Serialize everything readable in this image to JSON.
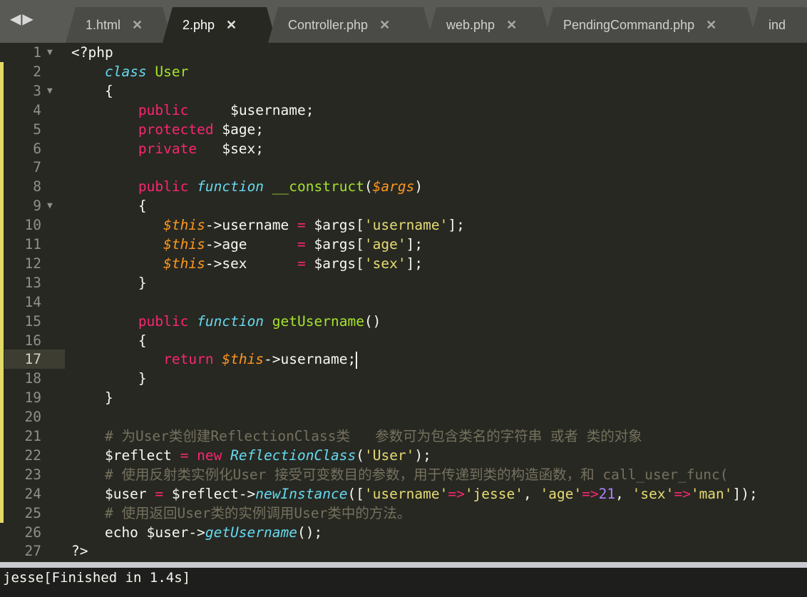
{
  "tabs": [
    {
      "label": "1.html",
      "active": false
    },
    {
      "label": "2.php",
      "active": true
    },
    {
      "label": "Controller.php",
      "active": false
    },
    {
      "label": "web.php",
      "active": false
    },
    {
      "label": "PendingCommand.php",
      "active": false
    },
    {
      "label": "ind",
      "active": false
    }
  ],
  "nav_arrows": "◀▶",
  "close_glyph": "✕",
  "fold_glyph": "▼",
  "current_line": 17,
  "code": {
    "lines": [
      {
        "n": "1",
        "fold": true,
        "tokens": [
          [
            "<?php",
            ""
          ]
        ]
      },
      {
        "n": "2",
        "tokens": [
          [
            "    ",
            ""
          ],
          [
            "class",
            "t-st"
          ],
          [
            " ",
            ""
          ],
          [
            "User",
            "t-cl"
          ]
        ]
      },
      {
        "n": "3",
        "fold": true,
        "tokens": [
          [
            "    {",
            ""
          ]
        ]
      },
      {
        "n": "4",
        "tokens": [
          [
            "        ",
            ""
          ],
          [
            "public",
            "t-kw"
          ],
          [
            "     $username;",
            ""
          ]
        ]
      },
      {
        "n": "5",
        "tokens": [
          [
            "        ",
            ""
          ],
          [
            "protected",
            "t-kw"
          ],
          [
            " $age;",
            ""
          ]
        ]
      },
      {
        "n": "6",
        "tokens": [
          [
            "        ",
            ""
          ],
          [
            "private",
            "t-kw"
          ],
          [
            "   $sex;",
            ""
          ]
        ]
      },
      {
        "n": "7",
        "tokens": []
      },
      {
        "n": "8",
        "tokens": [
          [
            "        ",
            ""
          ],
          [
            "public",
            "t-kw"
          ],
          [
            " ",
            ""
          ],
          [
            "function",
            "t-st"
          ],
          [
            " ",
            ""
          ],
          [
            "__construct",
            "t-fn"
          ],
          [
            "(",
            ""
          ],
          [
            "$args",
            "t-var"
          ],
          [
            ")",
            ""
          ]
        ]
      },
      {
        "n": "9",
        "fold": true,
        "tokens": [
          [
            "        {",
            ""
          ]
        ]
      },
      {
        "n": "10",
        "tokens": [
          [
            "           ",
            ""
          ],
          [
            "$this",
            "t-var"
          ],
          [
            "->username ",
            ""
          ],
          [
            "=",
            "t-kw"
          ],
          [
            " $args[",
            ""
          ],
          [
            "'username'",
            "t-str"
          ],
          [
            "];",
            ""
          ]
        ]
      },
      {
        "n": "11",
        "tokens": [
          [
            "           ",
            ""
          ],
          [
            "$this",
            "t-var"
          ],
          [
            "->age      ",
            ""
          ],
          [
            "=",
            "t-kw"
          ],
          [
            " $args[",
            ""
          ],
          [
            "'age'",
            "t-str"
          ],
          [
            "];",
            ""
          ]
        ]
      },
      {
        "n": "12",
        "tokens": [
          [
            "           ",
            ""
          ],
          [
            "$this",
            "t-var"
          ],
          [
            "->sex      ",
            ""
          ],
          [
            "=",
            "t-kw"
          ],
          [
            " $args[",
            ""
          ],
          [
            "'sex'",
            "t-str"
          ],
          [
            "];",
            ""
          ]
        ]
      },
      {
        "n": "13",
        "tokens": [
          [
            "        }",
            ""
          ]
        ]
      },
      {
        "n": "14",
        "tokens": []
      },
      {
        "n": "15",
        "tokens": [
          [
            "        ",
            ""
          ],
          [
            "public",
            "t-kw"
          ],
          [
            " ",
            ""
          ],
          [
            "function",
            "t-st"
          ],
          [
            " ",
            ""
          ],
          [
            "getUsername",
            "t-fn"
          ],
          [
            "()",
            ""
          ]
        ]
      },
      {
        "n": "16",
        "tokens": [
          [
            "        {",
            ""
          ]
        ]
      },
      {
        "n": "17",
        "tokens": [
          [
            "           ",
            ""
          ],
          [
            "return",
            "t-kw"
          ],
          [
            " ",
            ""
          ],
          [
            "$this",
            "t-var"
          ],
          [
            "->username;",
            ""
          ]
        ]
      },
      {
        "n": "18",
        "tokens": [
          [
            "        }",
            ""
          ]
        ]
      },
      {
        "n": "19",
        "tokens": [
          [
            "    }",
            ""
          ]
        ]
      },
      {
        "n": "20",
        "tokens": []
      },
      {
        "n": "21",
        "tokens": [
          [
            "    ",
            ""
          ],
          [
            "# 为User类创建ReflectionClass类   参数可为包含类名的字符串 或者 类的对象",
            "t-cm"
          ]
        ]
      },
      {
        "n": "22",
        "tokens": [
          [
            "    $reflect ",
            ""
          ],
          [
            "=",
            "t-kw"
          ],
          [
            " ",
            ""
          ],
          [
            "new",
            "t-kw"
          ],
          [
            " ",
            ""
          ],
          [
            "ReflectionClass",
            "t-sp"
          ],
          [
            "(",
            ""
          ],
          [
            "'User'",
            "t-str"
          ],
          [
            ");",
            ""
          ]
        ]
      },
      {
        "n": "23",
        "tokens": [
          [
            "    ",
            ""
          ],
          [
            "# 使用反射类实例化User 接受可变数目的参数，用于传递到类的构造函数，和 call_user_func(",
            "t-cm"
          ]
        ]
      },
      {
        "n": "24",
        "tokens": [
          [
            "    $user ",
            ""
          ],
          [
            "=",
            "t-kw"
          ],
          [
            " $reflect->",
            ""
          ],
          [
            "newInstance",
            "t-sp"
          ],
          [
            "([",
            ""
          ],
          [
            "'username'",
            "t-str"
          ],
          [
            "=>",
            "t-kw"
          ],
          [
            "'jesse'",
            "t-str"
          ],
          [
            ", ",
            ""
          ],
          [
            "'age'",
            "t-str"
          ],
          [
            "=>",
            "t-kw"
          ],
          [
            "21",
            "t-num"
          ],
          [
            ", ",
            ""
          ],
          [
            "'sex'",
            "t-str"
          ],
          [
            "=>",
            "t-kw"
          ],
          [
            "'man'",
            "t-str"
          ],
          [
            "]);",
            ""
          ]
        ]
      },
      {
        "n": "25",
        "tokens": [
          [
            "    ",
            ""
          ],
          [
            "# 使用返回User类的实例调用User类中的方法。",
            "t-cm"
          ]
        ]
      },
      {
        "n": "26",
        "tokens": [
          [
            "    echo $user->",
            ""
          ],
          [
            "getUsername",
            "t-sp"
          ],
          [
            "();",
            ""
          ]
        ]
      },
      {
        "n": "27",
        "tokens": [
          [
            "?>",
            ""
          ]
        ]
      }
    ]
  },
  "output": {
    "text": "jesse[Finished in 1.4s]"
  },
  "colors": {
    "background": "#272822",
    "keyword": "#f92672",
    "storage": "#66d9ef",
    "string": "#e6db74",
    "number": "#ae81ff",
    "comment": "#75715e",
    "modified_marker": "#e3d966"
  }
}
